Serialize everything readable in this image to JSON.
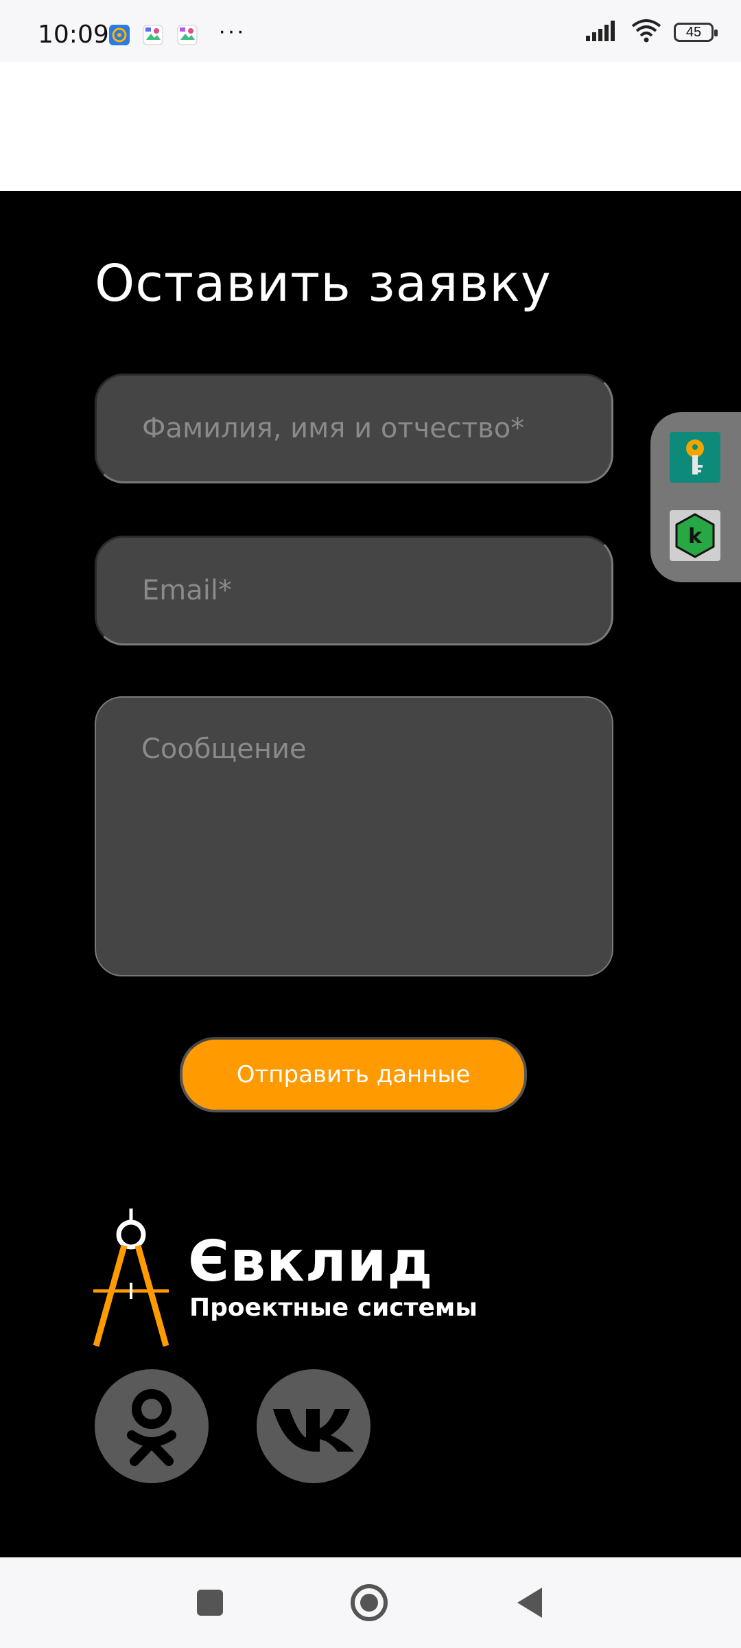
{
  "status_bar": {
    "time": "10:09",
    "more": "···",
    "battery": "45",
    "icons": [
      "mail-app-icon",
      "gallery-app-icon",
      "gallery-app-icon",
      "signal-icon",
      "wifi-icon",
      "battery-icon"
    ]
  },
  "form": {
    "title": "Оставить заявку",
    "name_placeholder": "Фамилия, имя и отчество*",
    "email_placeholder": "Email*",
    "message_placeholder": "Сообщение",
    "submit_label": "Отправить данные"
  },
  "brand": {
    "name": "Євклид",
    "tagline": "Проектные системы"
  },
  "social": [
    "odnoklassniki-icon",
    "vk-icon"
  ],
  "side_panel": [
    "key-icon",
    "kaspersky-icon"
  ],
  "colors": {
    "background": "#000000",
    "field": "#454545",
    "accent": "#ff9a00",
    "social_bg": "#5a5a5a"
  }
}
